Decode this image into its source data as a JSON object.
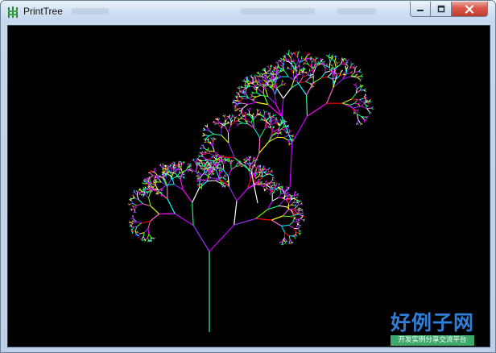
{
  "window": {
    "title": "PrintTree",
    "app_icon": "tree-app-icon",
    "controls": {
      "minimize_icon": "minimize-icon",
      "maximize_icon": "maximize-icon",
      "close_icon": "close-icon"
    }
  },
  "canvas": {
    "background": "#000000"
  },
  "watermark": {
    "title": "好例子网",
    "subtitle": "开发实例分享交流平台"
  },
  "colors": {
    "branch_palette": [
      "#00ff66",
      "#8a2be2",
      "#ff00ff",
      "#00ffff",
      "#ff0000",
      "#ffff00",
      "#ffffff",
      "#9933ff",
      "#33ff99",
      "#ff66cc",
      "#66ff00",
      "#cc00ff"
    ],
    "close_button": "#c13c2d",
    "titlebar": "#d3e2f3",
    "watermark_text": "#2f7fd8",
    "watermark_band": "#3fa86b"
  }
}
